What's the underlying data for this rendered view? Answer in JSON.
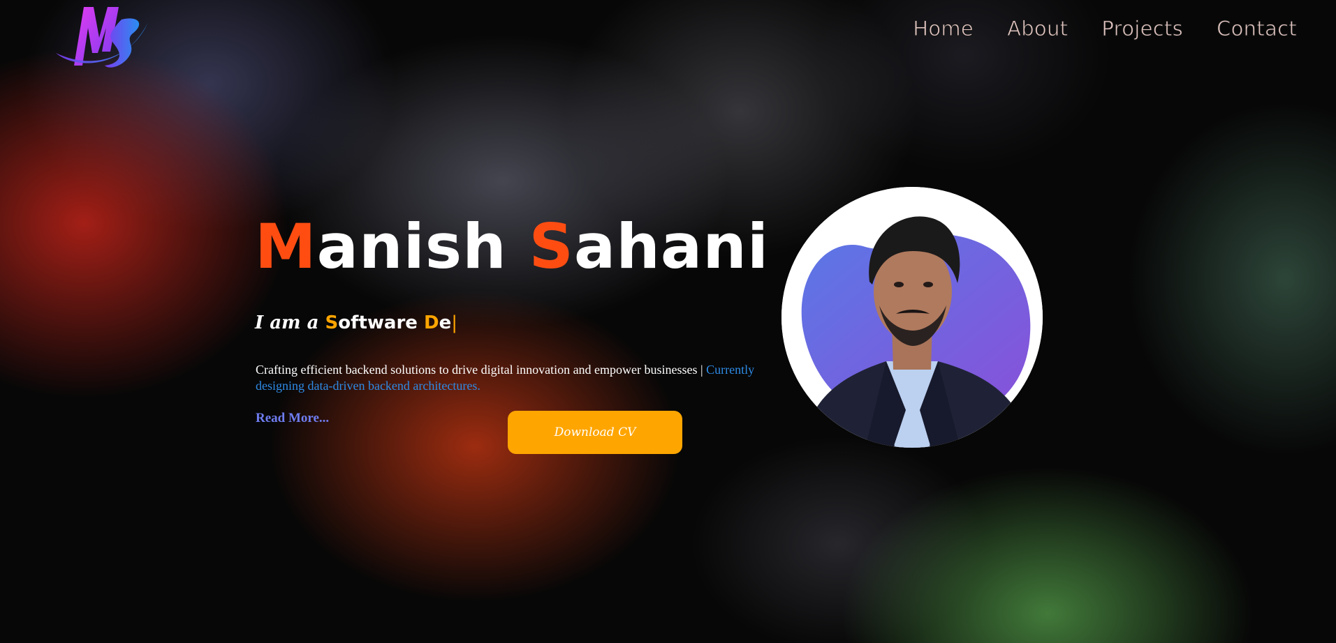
{
  "brand": {
    "logo_text": "MS"
  },
  "nav": {
    "home": "Home",
    "about": "About",
    "projects": "Projects",
    "contact": "Contact"
  },
  "hero": {
    "name_first_initial": "M",
    "name_first_rest": "anish",
    "name_last_initial": "S",
    "name_last_rest": "ahani",
    "role_prefix": "I am a",
    "role_initial_1": "S",
    "role_word_1_rest": "oftware",
    "role_initial_2": "D",
    "role_word_2_rest": "e",
    "caret": "|",
    "description": "Crafting efficient backend solutions to drive digital innovation and empower businesses",
    "separator": "|",
    "description_highlight": "Currently designing data-driven backend architectures.",
    "read_more": "Read More...",
    "download_cv": "Download CV"
  },
  "colors": {
    "accent_orange_red": "#ff4d12",
    "accent_orange": "#ffa500",
    "link_blue": "#2e8be6",
    "read_more": "#6f7df0"
  },
  "icons": {
    "logo": "ms-logo-icon",
    "avatar": "profile-photo"
  }
}
